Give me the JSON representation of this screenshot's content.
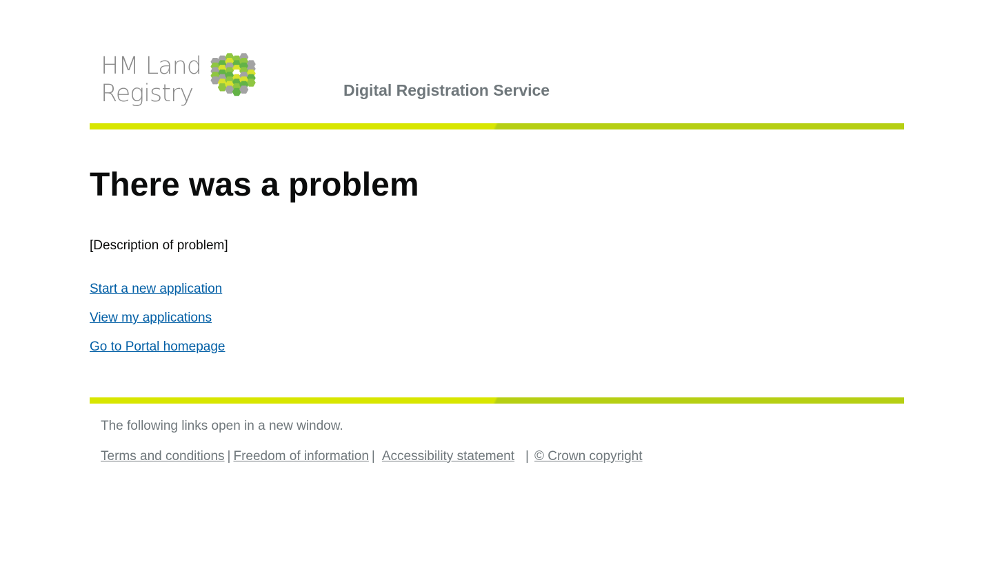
{
  "header": {
    "logo_line1": "HM Land",
    "logo_line2": "Registry",
    "service_name": "Digital Registration Service"
  },
  "main": {
    "title": "There was a problem",
    "description": "[Description of problem]",
    "links": [
      {
        "label": "Start a new application"
      },
      {
        "label": "View my applications"
      },
      {
        "label": "Go to Portal homepage"
      }
    ]
  },
  "footer": {
    "note": "The following links open in a new window.",
    "links": [
      {
        "label": "Terms and conditions"
      },
      {
        "label": "Freedom of information"
      },
      {
        "label": "Accessibility statement"
      },
      {
        "label": "© Crown copyright"
      }
    ],
    "separator": "|"
  },
  "colors": {
    "stripe_light": "#d8e600",
    "stripe_dark": "#b6cf13",
    "link": "#005ea5",
    "text": "#0b0c0c",
    "muted": "#6f777b"
  }
}
